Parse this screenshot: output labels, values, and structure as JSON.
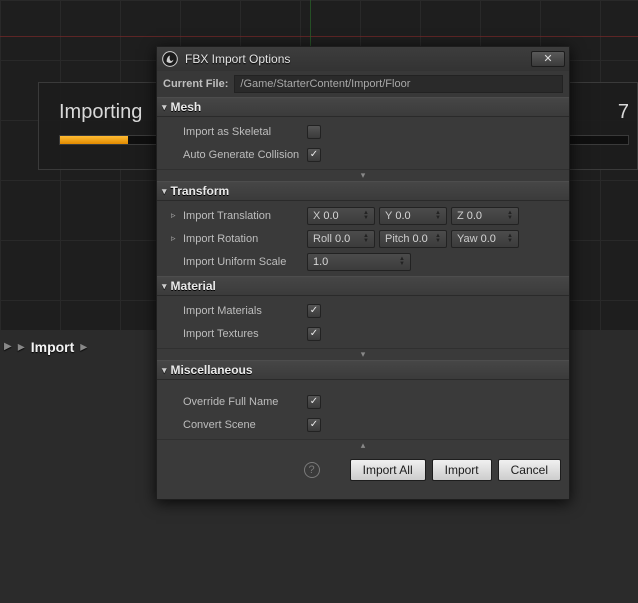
{
  "progress": {
    "label": "Importing",
    "percent_text": "7"
  },
  "breadcrumb": {
    "current": "Import"
  },
  "dialog": {
    "title": "FBX Import Options",
    "current_file_label": "Current File:",
    "current_file_path": "/Game/StarterContent/Import/Floor"
  },
  "sections": {
    "mesh": {
      "title": "Mesh",
      "import_as_skeletal": {
        "label": "Import as Skeletal",
        "checked": false
      },
      "auto_generate_collision": {
        "label": "Auto Generate Collision",
        "checked": true
      }
    },
    "transform": {
      "title": "Transform",
      "import_translation": {
        "label": "Import Translation",
        "x": {
          "key": "X",
          "val": "0.0"
        },
        "y": {
          "key": "Y",
          "val": "0.0"
        },
        "z": {
          "key": "Z",
          "val": "0.0"
        }
      },
      "import_rotation": {
        "label": "Import Rotation",
        "roll": {
          "key": "Roll",
          "val": "0.0"
        },
        "pitch": {
          "key": "Pitch",
          "val": "0.0"
        },
        "yaw": {
          "key": "Yaw",
          "val": "0.0"
        }
      },
      "import_uniform_scale": {
        "label": "Import Uniform Scale",
        "val": "1.0"
      }
    },
    "material": {
      "title": "Material",
      "import_materials": {
        "label": "Import Materials",
        "checked": true
      },
      "import_textures": {
        "label": "Import Textures",
        "checked": true
      }
    },
    "misc": {
      "title": "Miscellaneous",
      "override_full_name": {
        "label": "Override Full Name",
        "checked": true
      },
      "convert_scene": {
        "label": "Convert Scene",
        "checked": true
      }
    }
  },
  "buttons": {
    "import_all": "Import All",
    "import": "Import",
    "cancel": "Cancel"
  }
}
